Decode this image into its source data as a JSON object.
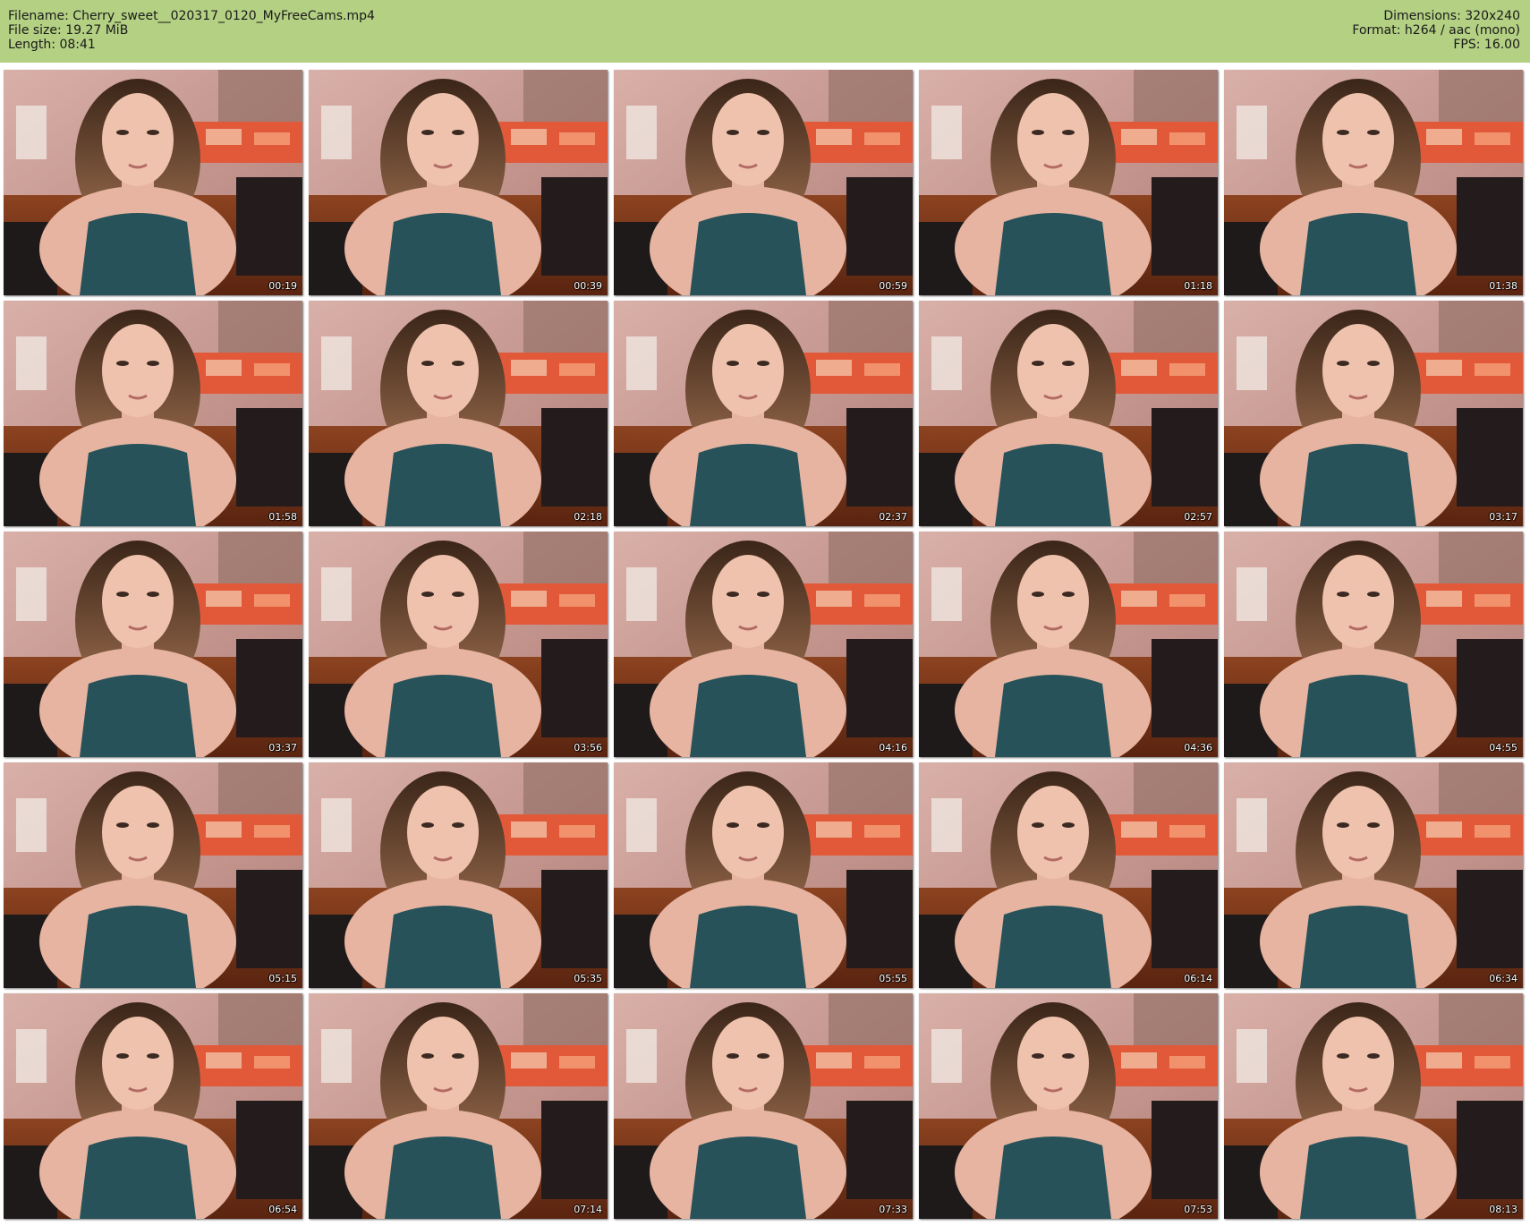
{
  "info": {
    "filename": "Filename: Cherry_sweet__020317_0120_MyFreeCams.mp4",
    "file_size": "File size: 19.27 MiB",
    "length": "Length: 08:41",
    "dimensions": "Dimensions: 320x240",
    "format": "Format: h264 / aac (mono)",
    "fps": "FPS: 16.00"
  },
  "colors": {
    "header_background": "#b3d083",
    "wall": "#c99a90",
    "floor": "#7a3a1e",
    "top_garment": "#27525a",
    "red_fabric": "#c91f3a"
  },
  "thumbnails": [
    {
      "time": "00:19"
    },
    {
      "time": "00:39"
    },
    {
      "time": "00:59"
    },
    {
      "time": "01:18"
    },
    {
      "time": "01:38"
    },
    {
      "time": "01:58"
    },
    {
      "time": "02:18"
    },
    {
      "time": "02:37"
    },
    {
      "time": "02:57"
    },
    {
      "time": "03:17"
    },
    {
      "time": "03:37"
    },
    {
      "time": "03:56"
    },
    {
      "time": "04:16"
    },
    {
      "time": "04:36"
    },
    {
      "time": "04:55"
    },
    {
      "time": "05:15"
    },
    {
      "time": "05:35"
    },
    {
      "time": "05:55"
    },
    {
      "time": "06:14"
    },
    {
      "time": "06:34"
    },
    {
      "time": "06:54"
    },
    {
      "time": "07:14"
    },
    {
      "time": "07:33"
    },
    {
      "time": "07:53"
    },
    {
      "time": "08:13"
    }
  ]
}
